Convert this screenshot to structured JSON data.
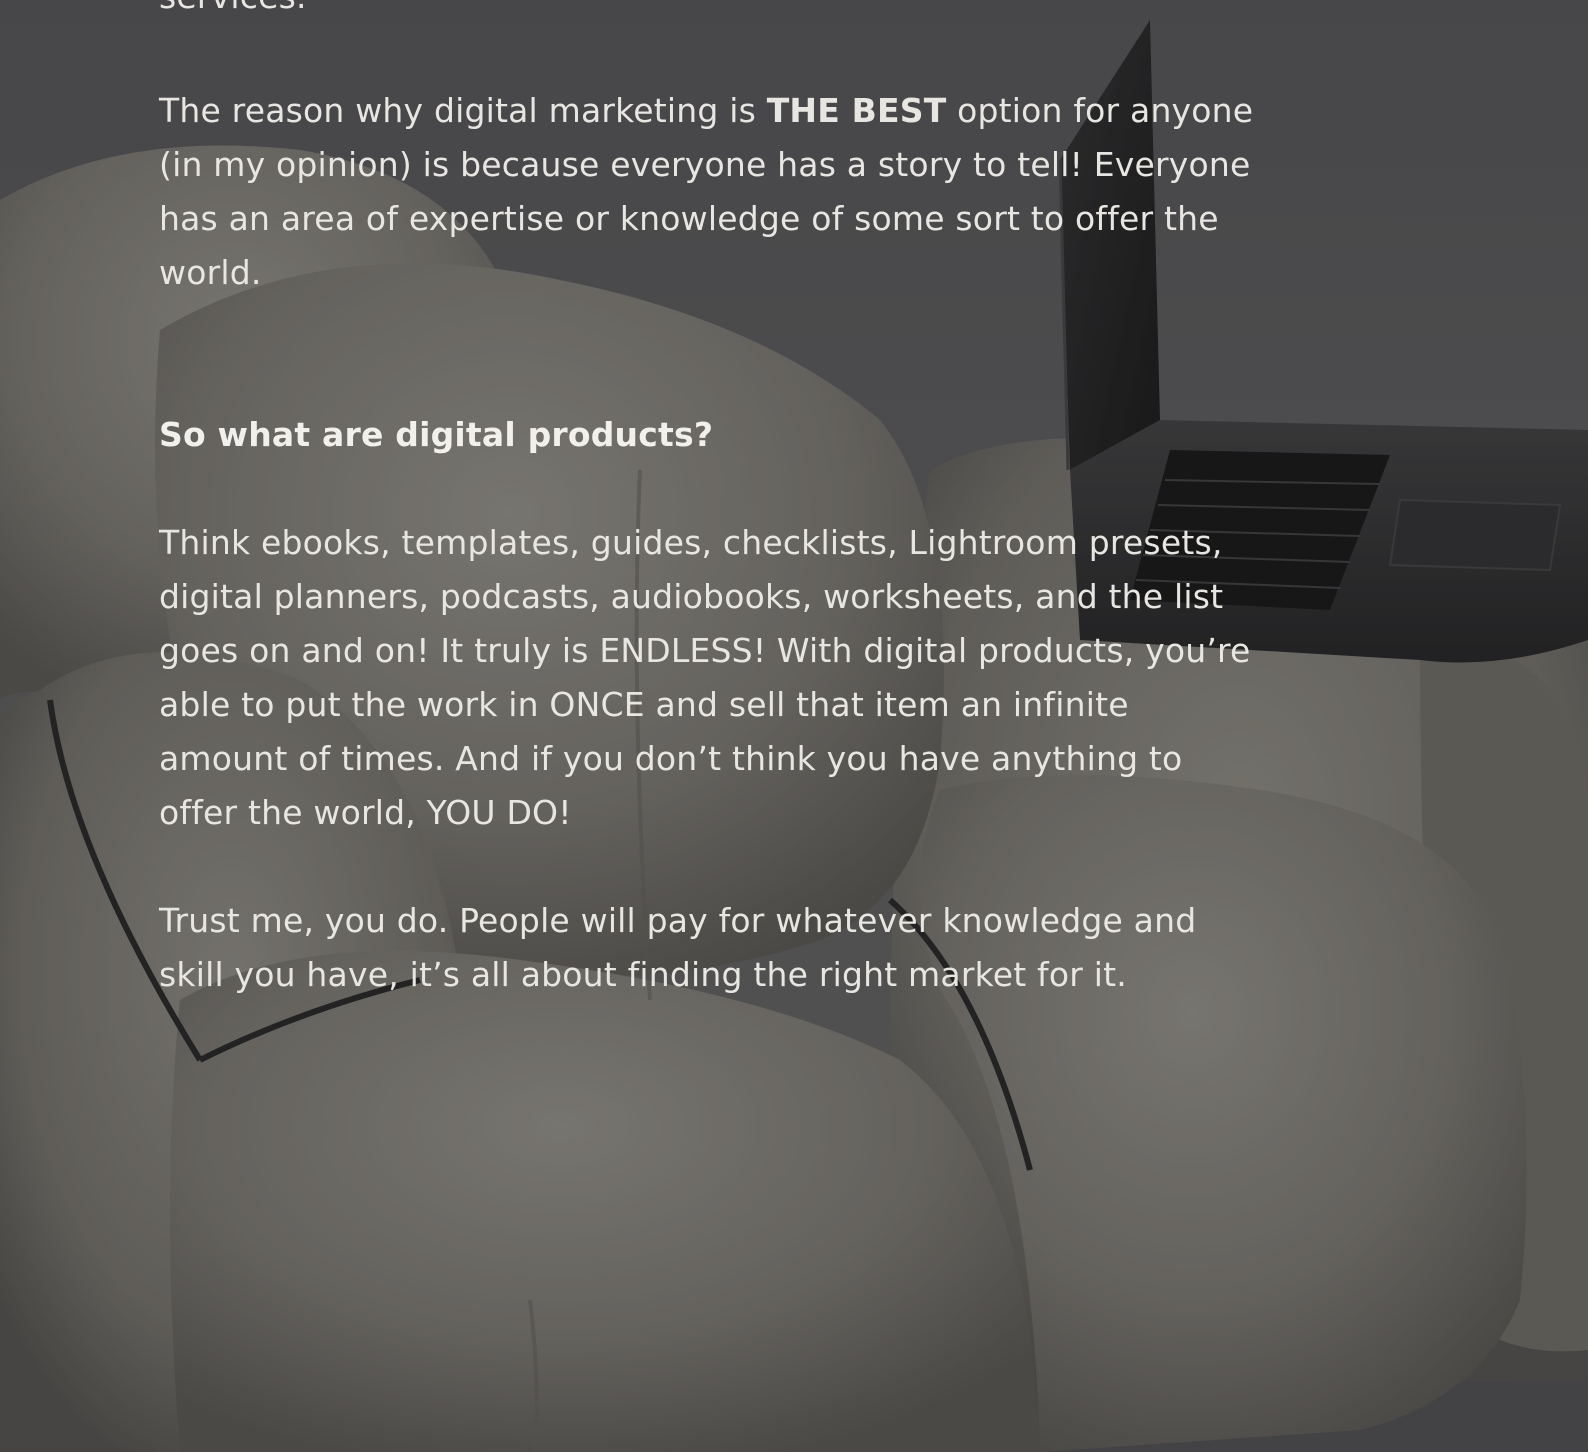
{
  "article": {
    "intro_tail": "services.",
    "p1": {
      "line1_before": "The reason why digital marketing is ",
      "line1_bold": "THE BEST",
      "line1_after": " option for anyone",
      "line2": "(in my opinion) is because everyone has a story to tell! Everyone",
      "line3": "has an area of expertise or knowledge of some sort to offer the",
      "line4": "world."
    },
    "heading": "So what are digital products?",
    "p2": {
      "line1": "Think ebooks, templates, guides, checklists, Lightroom presets,",
      "line2": "digital planners, podcasts, audiobooks, worksheets, and the list",
      "line3": "goes on and on! It truly is ENDLESS! With digital products, you’re",
      "line4": "able to put the work in ONCE and sell that item an infinite",
      "line5": "amount of times. And if you don’t think you have anything to",
      "line6": "offer the world, YOU DO!"
    },
    "p3": {
      "line1": "Trust me, you do. People will pay for whatever knowledge and",
      "line2": "skill you have, it’s all about finding the right market for it."
    }
  },
  "colors": {
    "text": "#e8e6e1",
    "sofa": "#8a8780",
    "laptop": "#1c1c1d"
  }
}
